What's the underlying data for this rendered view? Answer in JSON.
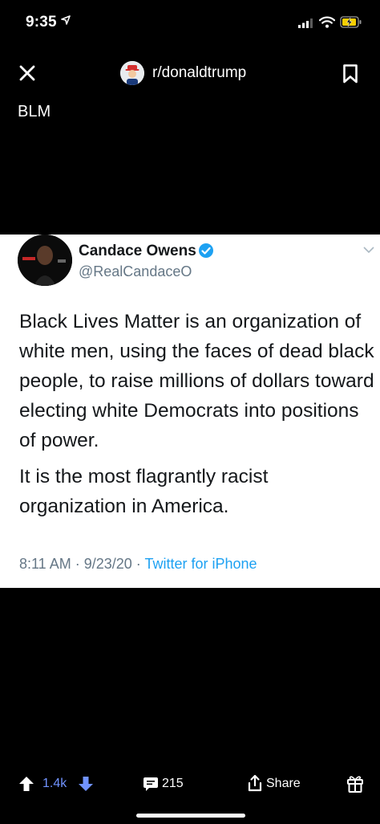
{
  "status_bar": {
    "time": "9:35"
  },
  "nav": {
    "subreddit": "r/donaldtrump"
  },
  "post": {
    "title": "BLM"
  },
  "tweet": {
    "name": "Candace Owens",
    "handle": "@RealCandaceO",
    "body": [
      "Black Lives Matter is an organization of white men, using the faces of dead black people, to raise millions of dollars toward electing white Democrats into positions of power.",
      "It is the most flagrantly racist organization in America."
    ],
    "time_date": "8:11 AM · 9/23/20 · ",
    "source": "Twitter for iPhone",
    "verified_color": "#1da1f2"
  },
  "bottom_bar": {
    "votes": "1.4k",
    "comments": "215",
    "share_label": "Share",
    "vote_color": "#7193ff"
  }
}
